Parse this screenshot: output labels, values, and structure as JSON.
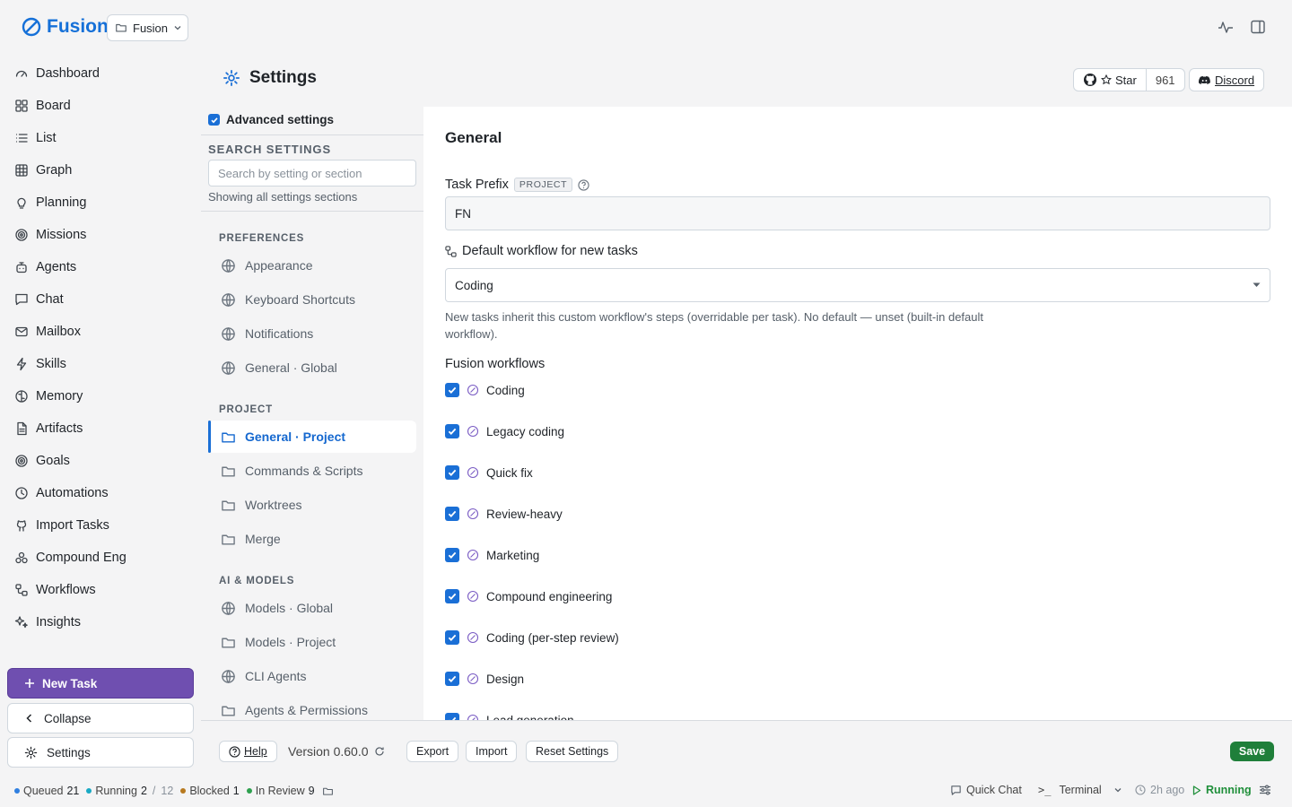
{
  "app": {
    "name": "Fusion",
    "project": "Fusion"
  },
  "nav": {
    "items": [
      {
        "label": "Dashboard",
        "icon": "dashboard-icon"
      },
      {
        "label": "Board",
        "icon": "board-icon"
      },
      {
        "label": "List",
        "icon": "list-icon"
      },
      {
        "label": "Graph",
        "icon": "table-icon"
      },
      {
        "label": "Planning",
        "icon": "lightbulb-icon"
      },
      {
        "label": "Missions",
        "icon": "target-icon"
      },
      {
        "label": "Agents",
        "icon": "robot-icon"
      },
      {
        "label": "Chat",
        "icon": "chat-icon"
      },
      {
        "label": "Mailbox",
        "icon": "mail-icon"
      },
      {
        "label": "Skills",
        "icon": "lightning-icon"
      },
      {
        "label": "Memory",
        "icon": "brain-icon"
      },
      {
        "label": "Artifacts",
        "icon": "file-icon"
      },
      {
        "label": "Goals",
        "icon": "target-icon"
      },
      {
        "label": "Automations",
        "icon": "clock-icon"
      },
      {
        "label": "Import Tasks",
        "icon": "github-icon"
      },
      {
        "label": "Compound Eng",
        "icon": "compound-icon"
      },
      {
        "label": "Workflows",
        "icon": "workflow-icon"
      },
      {
        "label": "Insights",
        "icon": "sparkles-icon"
      }
    ],
    "new_task": "New Task",
    "collapse": "Collapse",
    "settings": "Settings"
  },
  "header": {
    "title": "Settings",
    "star_label": "Star",
    "star_count": "961",
    "discord_label": "Discord"
  },
  "settings_nav": {
    "advanced_label": "Advanced settings",
    "advanced_checked": true,
    "search_heading": "SEARCH SETTINGS",
    "search_placeholder": "Search by setting or section",
    "search_status": "Showing all settings sections",
    "sections": [
      {
        "heading": "PREFERENCES",
        "items": [
          {
            "label": "Appearance",
            "icon": "globe-icon"
          },
          {
            "label": "Keyboard Shortcuts",
            "icon": "globe-icon"
          },
          {
            "label": "Notifications",
            "icon": "globe-icon"
          },
          {
            "label": "General · Global",
            "icon": "globe-icon"
          }
        ]
      },
      {
        "heading": "PROJECT",
        "items": [
          {
            "label": "General · Project",
            "icon": "folder-icon",
            "active": true
          },
          {
            "label": "Commands & Scripts",
            "icon": "folder-icon"
          },
          {
            "label": "Worktrees",
            "icon": "folder-icon"
          },
          {
            "label": "Merge",
            "icon": "folder-icon"
          }
        ]
      },
      {
        "heading": "AI & MODELS",
        "items": [
          {
            "label": "Models · Global",
            "icon": "globe-icon"
          },
          {
            "label": "Models · Project",
            "icon": "folder-icon"
          },
          {
            "label": "CLI Agents",
            "icon": "globe-icon"
          },
          {
            "label": "Agents & Permissions",
            "icon": "folder-icon"
          }
        ]
      }
    ]
  },
  "general": {
    "heading": "General",
    "task_prefix_label": "Task Prefix",
    "task_prefix_badge": "PROJECT",
    "task_prefix_value": "FN",
    "workflow_label": "Default workflow for new tasks",
    "workflow_value": "Coding",
    "workflow_help": "New tasks inherit this custom workflow's steps (overridable per task). No default — unset (built-in default workflow).",
    "fusion_workflows_heading": "Fusion workflows",
    "workflows": [
      {
        "label": "Coding",
        "checked": true
      },
      {
        "label": "Legacy coding",
        "checked": true
      },
      {
        "label": "Quick fix",
        "checked": true
      },
      {
        "label": "Review-heavy",
        "checked": true
      },
      {
        "label": "Marketing",
        "checked": true
      },
      {
        "label": "Compound engineering",
        "checked": true
      },
      {
        "label": "Coding (per-step review)",
        "checked": true
      },
      {
        "label": "Design",
        "checked": true
      },
      {
        "label": "Lead generation",
        "checked": true
      }
    ]
  },
  "footer": {
    "help": "Help",
    "version": "Version 0.60.0",
    "export": "Export",
    "import": "Import",
    "reset": "Reset Settings",
    "save": "Save"
  },
  "status": {
    "queued_label": "Queued",
    "queued_count": "21",
    "running_label": "Running",
    "running_count": "2",
    "running_sep": "/",
    "running_total": "12",
    "blocked_label": "Blocked",
    "blocked_count": "1",
    "review_label": "In Review",
    "review_count": "9",
    "quick_chat": "Quick Chat",
    "terminal": "Terminal",
    "time_ago": "2h ago",
    "engine_state": "Running",
    "colors": {
      "queued": "#2f7fe0",
      "running": "#19a9c4",
      "blocked": "#b7791f",
      "review": "#2ea04f",
      "engine": "#1f8f3a"
    }
  },
  "theme": {
    "accent": "#1a6fd6",
    "primary_button": "#6f4fb0",
    "save_button": "#1f7f3a"
  }
}
